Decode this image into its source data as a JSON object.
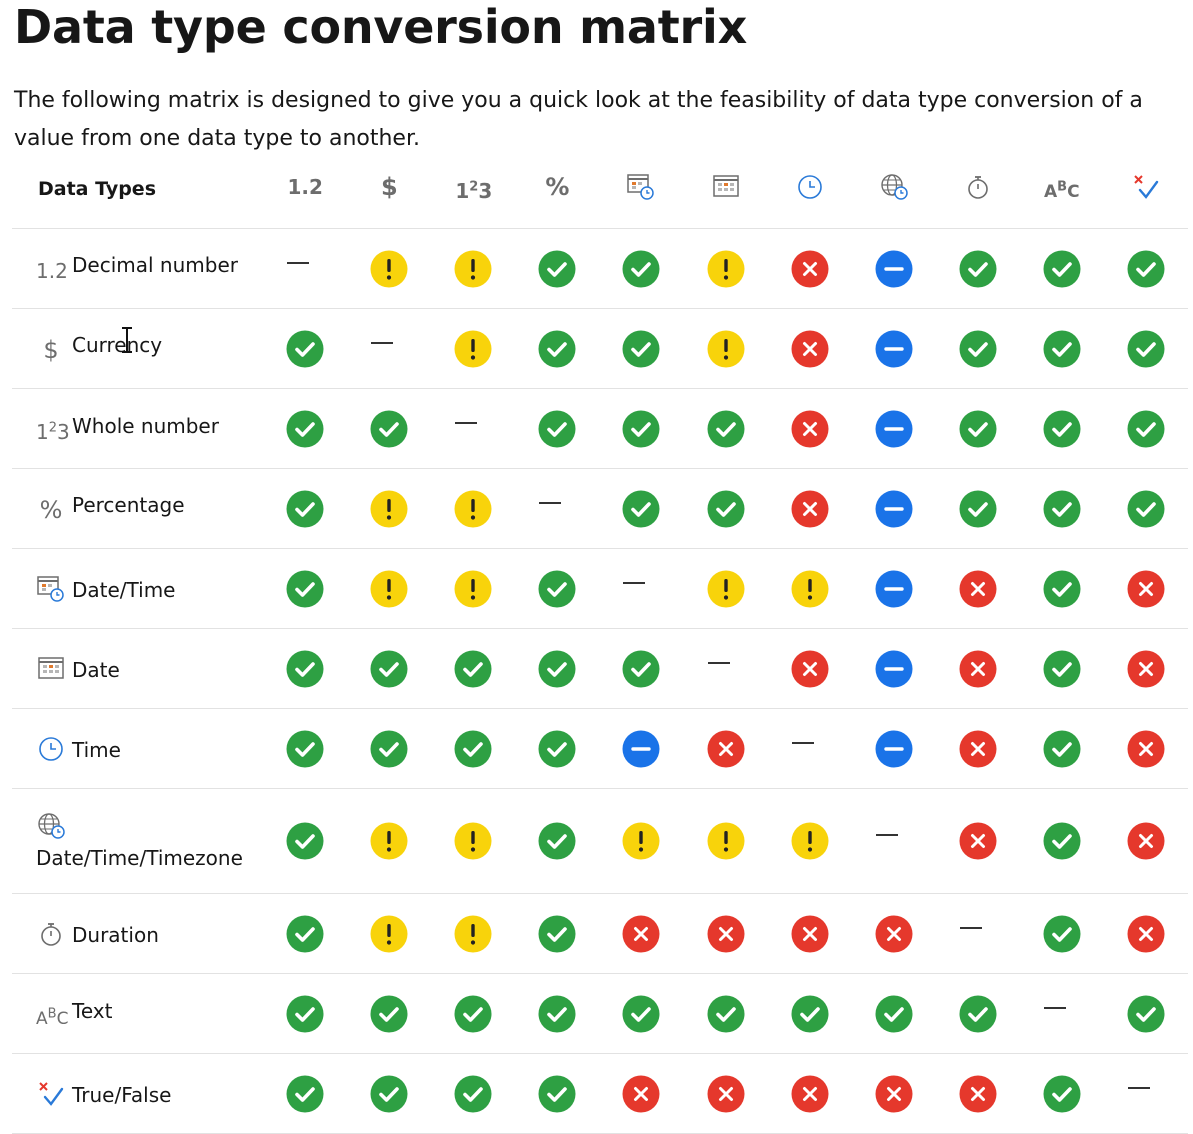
{
  "page": {
    "title": "Data type conversion matrix",
    "description": "The following matrix is designed to give you a quick look at the feasibility of data type conversion of a value from one data type to another."
  },
  "table": {
    "corner_label": "Data Types",
    "columns": [
      {
        "icon": "decimal-number-icon",
        "glyph": "1.2"
      },
      {
        "icon": "currency-icon",
        "glyph": "$"
      },
      {
        "icon": "whole-number-icon",
        "glyph": "123"
      },
      {
        "icon": "percentage-icon",
        "glyph": "%"
      },
      {
        "icon": "date-time-icon",
        "glyph": ""
      },
      {
        "icon": "date-icon",
        "glyph": ""
      },
      {
        "icon": "time-icon",
        "glyph": ""
      },
      {
        "icon": "date-time-timezone-icon",
        "glyph": ""
      },
      {
        "icon": "duration-icon",
        "glyph": ""
      },
      {
        "icon": "text-icon",
        "glyph": "ABC"
      },
      {
        "icon": "true-false-icon",
        "glyph": ""
      }
    ],
    "rows": [
      {
        "label": "Decimal number",
        "icon": "decimal-number-icon",
        "cells": [
          "none",
          "warn",
          "warn",
          "yes",
          "yes",
          "warn",
          "no",
          "na",
          "yes",
          "yes",
          "yes"
        ]
      },
      {
        "label": "Currency",
        "icon": "currency-icon",
        "cells": [
          "yes",
          "none",
          "warn",
          "yes",
          "yes",
          "warn",
          "no",
          "na",
          "yes",
          "yes",
          "yes"
        ]
      },
      {
        "label": "Whole number",
        "icon": "whole-number-icon",
        "cells": [
          "yes",
          "yes",
          "none",
          "yes",
          "yes",
          "yes",
          "no",
          "na",
          "yes",
          "yes",
          "yes"
        ]
      },
      {
        "label": "Percentage",
        "icon": "percentage-icon",
        "cells": [
          "yes",
          "warn",
          "warn",
          "none",
          "yes",
          "yes",
          "no",
          "na",
          "yes",
          "yes",
          "yes"
        ]
      },
      {
        "label": "Date/Time",
        "icon": "date-time-icon",
        "cells": [
          "yes",
          "warn",
          "warn",
          "yes",
          "none",
          "warn",
          "warn",
          "na",
          "no",
          "yes",
          "no"
        ]
      },
      {
        "label": "Date",
        "icon": "date-icon",
        "cells": [
          "yes",
          "yes",
          "yes",
          "yes",
          "yes",
          "none",
          "no",
          "na",
          "no",
          "yes",
          "no"
        ]
      },
      {
        "label": "Time",
        "icon": "time-icon",
        "cells": [
          "yes",
          "yes",
          "yes",
          "yes",
          "na",
          "no",
          "none",
          "na",
          "no",
          "yes",
          "no"
        ]
      },
      {
        "label": "Date/Time/Timezone",
        "icon": "date-time-timezone-icon",
        "cells": [
          "yes",
          "warn",
          "warn",
          "yes",
          "warn",
          "warn",
          "warn",
          "none",
          "no",
          "yes",
          "no"
        ]
      },
      {
        "label": "Duration",
        "icon": "duration-icon",
        "cells": [
          "yes",
          "warn",
          "warn",
          "yes",
          "no",
          "no",
          "no",
          "no",
          "none",
          "yes",
          "no"
        ]
      },
      {
        "label": "Text",
        "icon": "text-icon",
        "cells": [
          "yes",
          "yes",
          "yes",
          "yes",
          "yes",
          "yes",
          "yes",
          "yes",
          "yes",
          "none",
          "yes"
        ]
      },
      {
        "label": "True/False",
        "icon": "true-false-icon",
        "cells": [
          "yes",
          "yes",
          "yes",
          "yes",
          "no",
          "no",
          "no",
          "no",
          "no",
          "yes",
          "none"
        ]
      }
    ]
  },
  "colors": {
    "yes": "#2ea043",
    "warn": "#f8d30b",
    "no": "#e5382c",
    "na": "#1a73e8",
    "icon_gray": "#6d6d6d",
    "icon_blue": "#2a7ad8",
    "icon_orange": "#e07a2e"
  }
}
